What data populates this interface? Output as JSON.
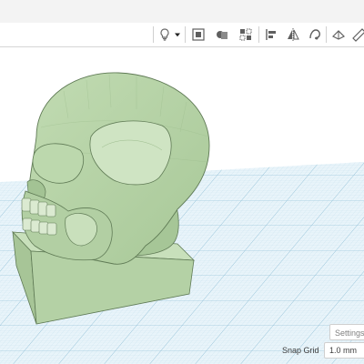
{
  "toolbar": {
    "icons": [
      "lightbulb-icon",
      "dropdown-arrow-icon",
      "group-icon",
      "ungroup-icon",
      "align-icon",
      "snap-points-icon",
      "align-left-icon",
      "mirror-icon",
      "cruise-icon",
      "workplane-icon",
      "ruler-icon"
    ]
  },
  "viewport": {
    "model": "skull-on-base",
    "model_color": "#b7d3a8",
    "grid_color": "#a9cfe3",
    "grid_background": "#e8f3f9"
  },
  "footer": {
    "settings_label": "Settings",
    "snap_grid_label": "Snap Grid",
    "snap_grid_value": "1.0 mm"
  }
}
